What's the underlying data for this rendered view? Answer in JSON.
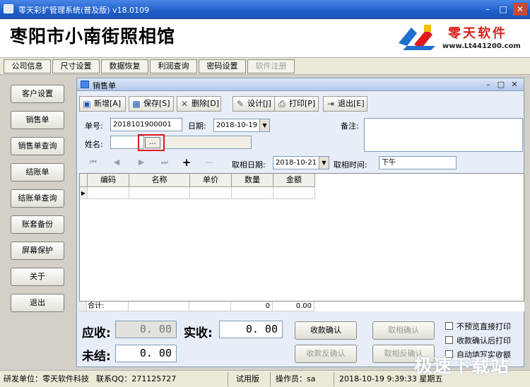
{
  "window": {
    "title": "零天彩扩管理系统(普及版)  v18.0109",
    "minimize": "–",
    "maximize": "□",
    "close": "✕"
  },
  "header": {
    "company_name": "枣阳市小南街照相馆",
    "logo_text": "零天软件",
    "logo_url": "www.Lt441200.com"
  },
  "topnav": {
    "items": [
      "公司信息",
      "尺寸设置",
      "数据恢复",
      "利润查询",
      "密码设置",
      "软件注册"
    ]
  },
  "sidebar": {
    "items": [
      "客户设置",
      "销售单",
      "销售单查询",
      "结账单",
      "结账单查询",
      "账套备份",
      "屏幕保护",
      "关于",
      "退出"
    ]
  },
  "child_window": {
    "title": "销售单",
    "minimize": "–",
    "maximize": "□",
    "close": "✕"
  },
  "toolbar": {
    "new": "新增[A]",
    "save": "保存[S]",
    "delete": "删除[D]",
    "design": "设计[J]",
    "print": "打印[P]",
    "exit": "退出[E]",
    "icons": {
      "new": "new-doc-icon",
      "save": "floppy-icon",
      "delete": "x-icon",
      "design": "design-icon",
      "print": "printer-icon",
      "exit": "exit-icon"
    }
  },
  "form": {
    "order_no_label": "单号:",
    "order_no_value": "2018101900001",
    "date_label": "日期:",
    "date_value": "2018-10-19",
    "remark_label": "备注:",
    "remark_value": "",
    "name_label": "姓名:",
    "name_value": "",
    "name_picker": "...",
    "pickup_date_label": "取相日期:",
    "pickup_date_value": "2018-10-21",
    "pickup_time_label": "取相时间:",
    "pickup_time_value": "下午"
  },
  "grid": {
    "columns": [
      "编码",
      "名称",
      "单价",
      "数量",
      "金额"
    ],
    "row_indicator": "▶",
    "sum_label": "合计:",
    "sum_qty": "0",
    "sum_amount": "0.00"
  },
  "totals": {
    "receivable_label": "应收:",
    "receivable_value": "0. 00",
    "received_label": "实收:",
    "received_value": "0. 00",
    "unsettled_label": "未结:",
    "unsettled_value": "0. 00"
  },
  "actions": {
    "confirm_payment": "收款确认",
    "reverse_payment": "收款反确认",
    "confirm_pickup": "取相确认",
    "reverse_pickup": "取相反确认"
  },
  "options": {
    "print_no_preview": "不预览直接打印",
    "print_after_payment": "收款确认后打印",
    "autofill_received": "自动填写实收额"
  },
  "status": {
    "developer": "研发单位：零天软件科技",
    "qq": "联系QQ：271125727",
    "edition": "试用版",
    "operator": "操作员：sa",
    "datetime": "2018-10-19  9:39:33 星期五"
  },
  "watermark": "极速下载站",
  "colors": {
    "titlebar": "#1e5fc9",
    "highlight_box": "#e0191b",
    "logo_red": "#d6211b"
  }
}
